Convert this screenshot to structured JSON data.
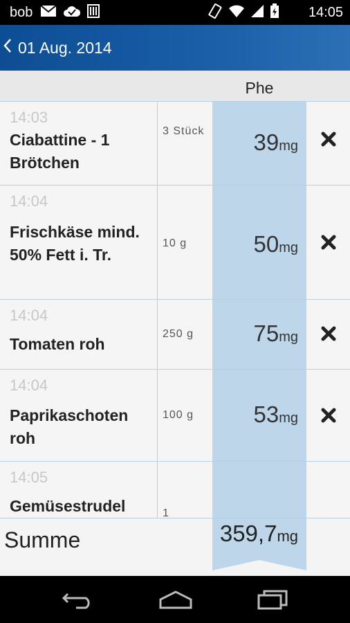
{
  "status_bar": {
    "user": "bob",
    "time": "14:05",
    "icons_left": [
      "mail-icon",
      "cloud-check-icon",
      "barcode-icon"
    ],
    "icons_right": [
      "rotate-icon",
      "wifi-icon",
      "signal-icon",
      "battery-icon"
    ]
  },
  "header": {
    "back_icon": "chevron-left-icon",
    "title": "01 Aug. 2014"
  },
  "columns": {
    "phe": "Phe"
  },
  "entries": [
    {
      "time": "14:03",
      "name": "Ciabattine - 1 Brötchen",
      "qty": "3 Stück",
      "amount": "39",
      "unit": "mg"
    },
    {
      "time": "14:04",
      "name": "Frischkäse mind. 50% Fett i. Tr.",
      "qty": "10 g",
      "amount": "50",
      "unit": "mg"
    },
    {
      "time": "14:04",
      "name": "Tomaten roh",
      "qty": "250 g",
      "amount": "75",
      "unit": "mg"
    },
    {
      "time": "14:04",
      "name": "Paprikaschoten roh",
      "qty": "100 g",
      "amount": "53",
      "unit": "mg"
    },
    {
      "time": "14:05",
      "name": "Gemüsestrudel",
      "qty": "1",
      "amount": "",
      "unit": ""
    }
  ],
  "summary": {
    "label": "Summe",
    "value": "359,7",
    "unit": "mg"
  },
  "colors": {
    "header": "#1a5fa7",
    "phe_band": "#bed6ea",
    "separator": "#b9cfe3"
  },
  "nav_bar": [
    "back-icon",
    "home-icon",
    "recents-icon"
  ]
}
